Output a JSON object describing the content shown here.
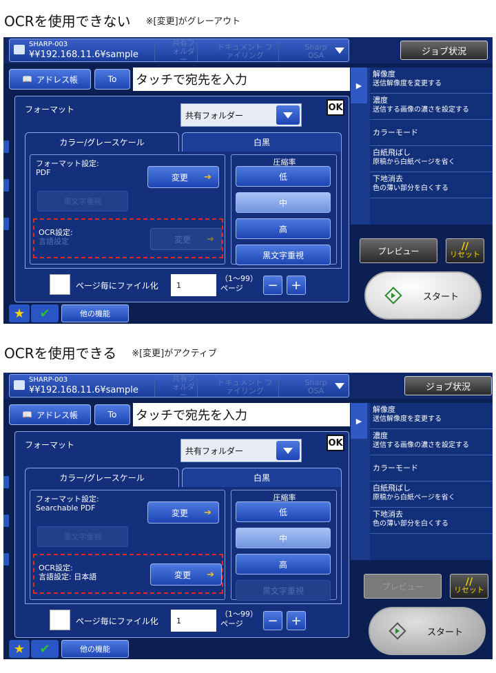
{
  "panels": [
    {
      "caption": {
        "main": "OCRを使用できない",
        "note": "※[変更]がグレーアウト"
      },
      "host": {
        "name": "SHARP-003",
        "path": "¥¥192.168.11.6¥sample"
      },
      "tabs_ghost": [
        "共有フォルダー",
        "ドキュメント ファイリング",
        "Sharp OSA"
      ],
      "job_status": "ジョブ状況",
      "address_book": "アドレス帳",
      "to": "To",
      "dest_placeholder": "タッチで宛先を入力",
      "dest_count": "1",
      "side": [
        {
          "t1": "解像度",
          "t2": "送信解像度を変更する"
        },
        {
          "t1": "濃度",
          "t2": "送信する画像の濃さを設定する"
        },
        {
          "t1": "カラーモード",
          "t2": ""
        },
        {
          "t1": "白紙飛ばし",
          "t2": "原稿から白紙ページを省く"
        },
        {
          "t1": "下地消去",
          "t2": "色の薄い部分を白くする"
        }
      ],
      "preview": "プレビュー",
      "preview_disabled": false,
      "reset": "リセット",
      "start": "スタート",
      "format_title": "フォーマット",
      "format_select": "共有フォルダー",
      "ok": "OK",
      "tab_color": "カラー/グレースケール",
      "tab_bw": "白黒",
      "format_setting": "フォーマット設定:",
      "format_value": "PDF",
      "change": "変更",
      "ghost_setting": "黒文字重視",
      "ocr_setting": "OCR設定:",
      "ocr_value": "言語設定",
      "ocr_disabled": true,
      "compression_title": "圧縮率",
      "compression": [
        "低",
        "中",
        "高",
        "黒文字重視"
      ],
      "compression_selected": 1,
      "compression_last_disabled": false,
      "per_page": "ページ毎にファイル化",
      "page_value": "1",
      "page_range": "（1～99）",
      "page_unit": "ページ",
      "other": "他の機能"
    },
    {
      "caption": {
        "main": "OCRを使用できる",
        "note": "※[変更]がアクティブ"
      },
      "host": {
        "name": "SHARP-003",
        "path": "¥¥192.168.11.6¥sample"
      },
      "tabs_ghost": [
        "共有フォルダー",
        "ドキュメント ファイリング",
        "Sharp OSA"
      ],
      "job_status": "ジョブ状況",
      "address_book": "アドレス帳",
      "to": "To",
      "dest_placeholder": "タッチで宛先を入力",
      "dest_count": "1",
      "side": [
        {
          "t1": "解像度",
          "t2": "送信解像度を変更する"
        },
        {
          "t1": "濃度",
          "t2": "送信する画像の濃さを設定する"
        },
        {
          "t1": "カラーモード",
          "t2": ""
        },
        {
          "t1": "白紙飛ばし",
          "t2": "原稿から白紙ページを省く"
        },
        {
          "t1": "下地消去",
          "t2": "色の薄い部分を白くする"
        }
      ],
      "preview": "プレビュー",
      "preview_disabled": true,
      "reset": "リセット",
      "start": "スタート",
      "format_title": "フォーマット",
      "format_select": "共有フォルダー",
      "ok": "OK",
      "tab_color": "カラー/グレースケール",
      "tab_bw": "白黒",
      "format_setting": "フォーマット設定:",
      "format_value": "Searchable PDF",
      "change": "変更",
      "ghost_setting": "黒文字重視",
      "ocr_setting": "OCR設定:",
      "ocr_value": "言語設定: 日本語",
      "ocr_disabled": false,
      "compression_title": "圧縮率",
      "compression": [
        "低",
        "中",
        "高",
        "黒文字重視"
      ],
      "compression_selected": 1,
      "compression_last_disabled": true,
      "per_page": "ページ毎にファイル化",
      "page_value": "1",
      "page_range": "（1～99）",
      "page_unit": "ページ",
      "other": "他の機能"
    }
  ]
}
